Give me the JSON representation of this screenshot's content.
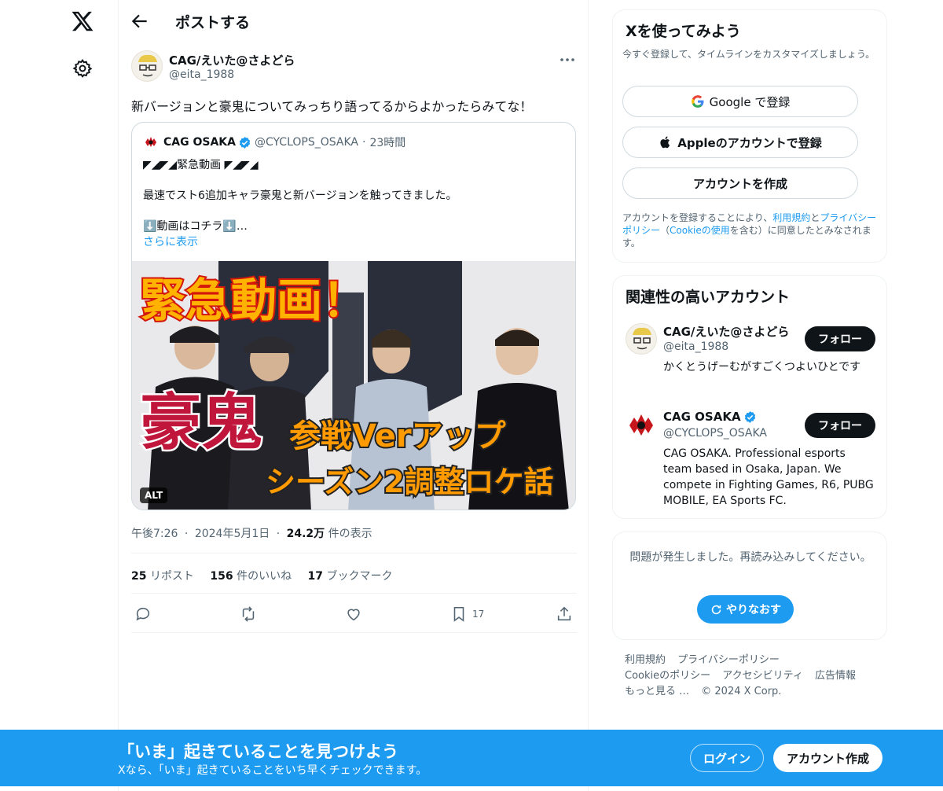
{
  "nav": {
    "logo_icon": "x-logo-icon",
    "settings_icon": "gear-icon"
  },
  "header": {
    "title": "ポストする"
  },
  "post": {
    "author_name": "CAG/えいた@さよどら",
    "author_handle": "@eita_1988",
    "text": "新バージョンと豪鬼についてみっちり語ってるからよかったらみてな！",
    "quote": {
      "name": "CAG OSAKA",
      "handle": "@CYCLOPS_OSAKA",
      "separator": "·",
      "time": "23時間",
      "line1": "◤◢◤◢緊急動画 ◤◢◤◢",
      "line2": "最速でスト6追加キャラ豪鬼と新バージョンを触ってきました。",
      "line3": "⬇️動画はコチラ⬇️…",
      "show_more": "さらに表示",
      "media": {
        "headline": "緊急動画！",
        "big": "豪鬼",
        "sub1": "参戦Verアップ",
        "sub2": "シーズン2調整ロケ話",
        "alt_badge": "ALT"
      }
    },
    "time": "午後7:26",
    "dot": "·",
    "date": "2024年5月1日",
    "views_value": "24.2万",
    "views_label": "件の表示",
    "reposts_value": "25",
    "reposts_label": "リポスト",
    "likes_value": "156",
    "likes_label": "件のいいね",
    "bookmarks_value": "17",
    "bookmarks_label": "ブックマーク",
    "bookmark_count": "17"
  },
  "signup": {
    "title": "Xを使ってみよう",
    "subtitle": "今すぐ登録して、タイムラインをカスタマイズしましょう。",
    "google_label": "Google で登録",
    "apple_label": "Appleのアカウントで登録",
    "create_label": "アカウントを作成",
    "terms_pre": "アカウントを登録することにより、",
    "terms_link1": "利用規約",
    "terms_mid1": "と",
    "terms_link2": "プライバシーポリシー",
    "terms_mid2": "（",
    "terms_link3": "Cookieの使用",
    "terms_post": "を含む）に同意したとみなされます。"
  },
  "related": {
    "title": "関連性の高いアカウント",
    "accounts": [
      {
        "name": "CAG/えいた@さよどら",
        "handle": "@eita_1988",
        "bio": "かくとうげーむがすごくつよいひとです",
        "follow": "フォロー"
      },
      {
        "name": "CAG OSAKA",
        "handle": "@CYCLOPS_OSAKA",
        "bio": "CAG OSAKA. Professional esports team based in Osaka, Japan. We compete in Fighting Games, R6, PUBG MOBILE, EA Sports FC.",
        "follow": "フォロー"
      }
    ]
  },
  "error": {
    "text": "問題が発生しました。再読み込みしてください。",
    "retry": "やりなおす"
  },
  "footer": {
    "links": [
      "利用規約",
      "プライバシーポリシー",
      "Cookieのポリシー",
      "アクセシビリティ",
      "広告情報",
      "もっと見る …"
    ],
    "copyright": "© 2024 X Corp."
  },
  "banner": {
    "title": "「いま」起きていることを見つけよう",
    "subtitle": "Xなら、「いま」起きていることをいち早くチェックできます。",
    "login": "ログイン",
    "signup": "アカウント作成"
  },
  "colors": {
    "accent": "#1d9bf0",
    "text": "#0f1419",
    "muted": "#536471",
    "border": "#eff3f4"
  }
}
